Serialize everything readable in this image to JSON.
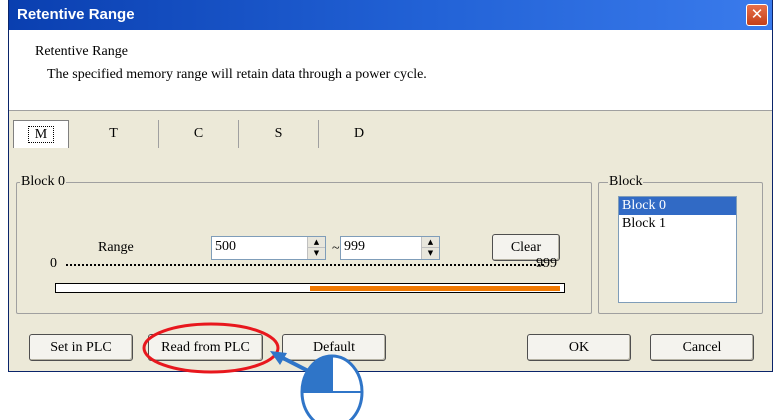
{
  "dialog": {
    "title": "Retentive Range",
    "close_glyph": "✕",
    "description_title": "Retentive Range",
    "description_text": "The specified memory range will retain data through a power cycle."
  },
  "tabs": [
    {
      "label": "M",
      "active": true
    },
    {
      "label": "T",
      "active": false
    },
    {
      "label": "C",
      "active": false
    },
    {
      "label": "S",
      "active": false
    },
    {
      "label": "D",
      "active": false
    }
  ],
  "block_group": {
    "legend": "Block 0",
    "range_label": "Range",
    "range_start": "500",
    "separator": "~",
    "range_end": "999",
    "clear_label": "Clear",
    "scale_min": "0",
    "scale_max": "999",
    "selected_fraction_start": 0.5,
    "selected_fraction_end": 1.0,
    "fill_color": "#f07800"
  },
  "block_list": {
    "legend": "Block",
    "items": [
      {
        "label": "Block 0",
        "selected": true
      },
      {
        "label": "Block 1",
        "selected": false
      }
    ]
  },
  "buttons": {
    "set_in_plc": "Set in PLC",
    "read_from_plc": "Read from PLC",
    "default": "Default",
    "ok": "OK",
    "cancel": "Cancel"
  },
  "annotation": {
    "highlight_color": "#e8171d",
    "arrow_color": "#2f75c8",
    "cursor_icon": "mouse-click-icon"
  }
}
